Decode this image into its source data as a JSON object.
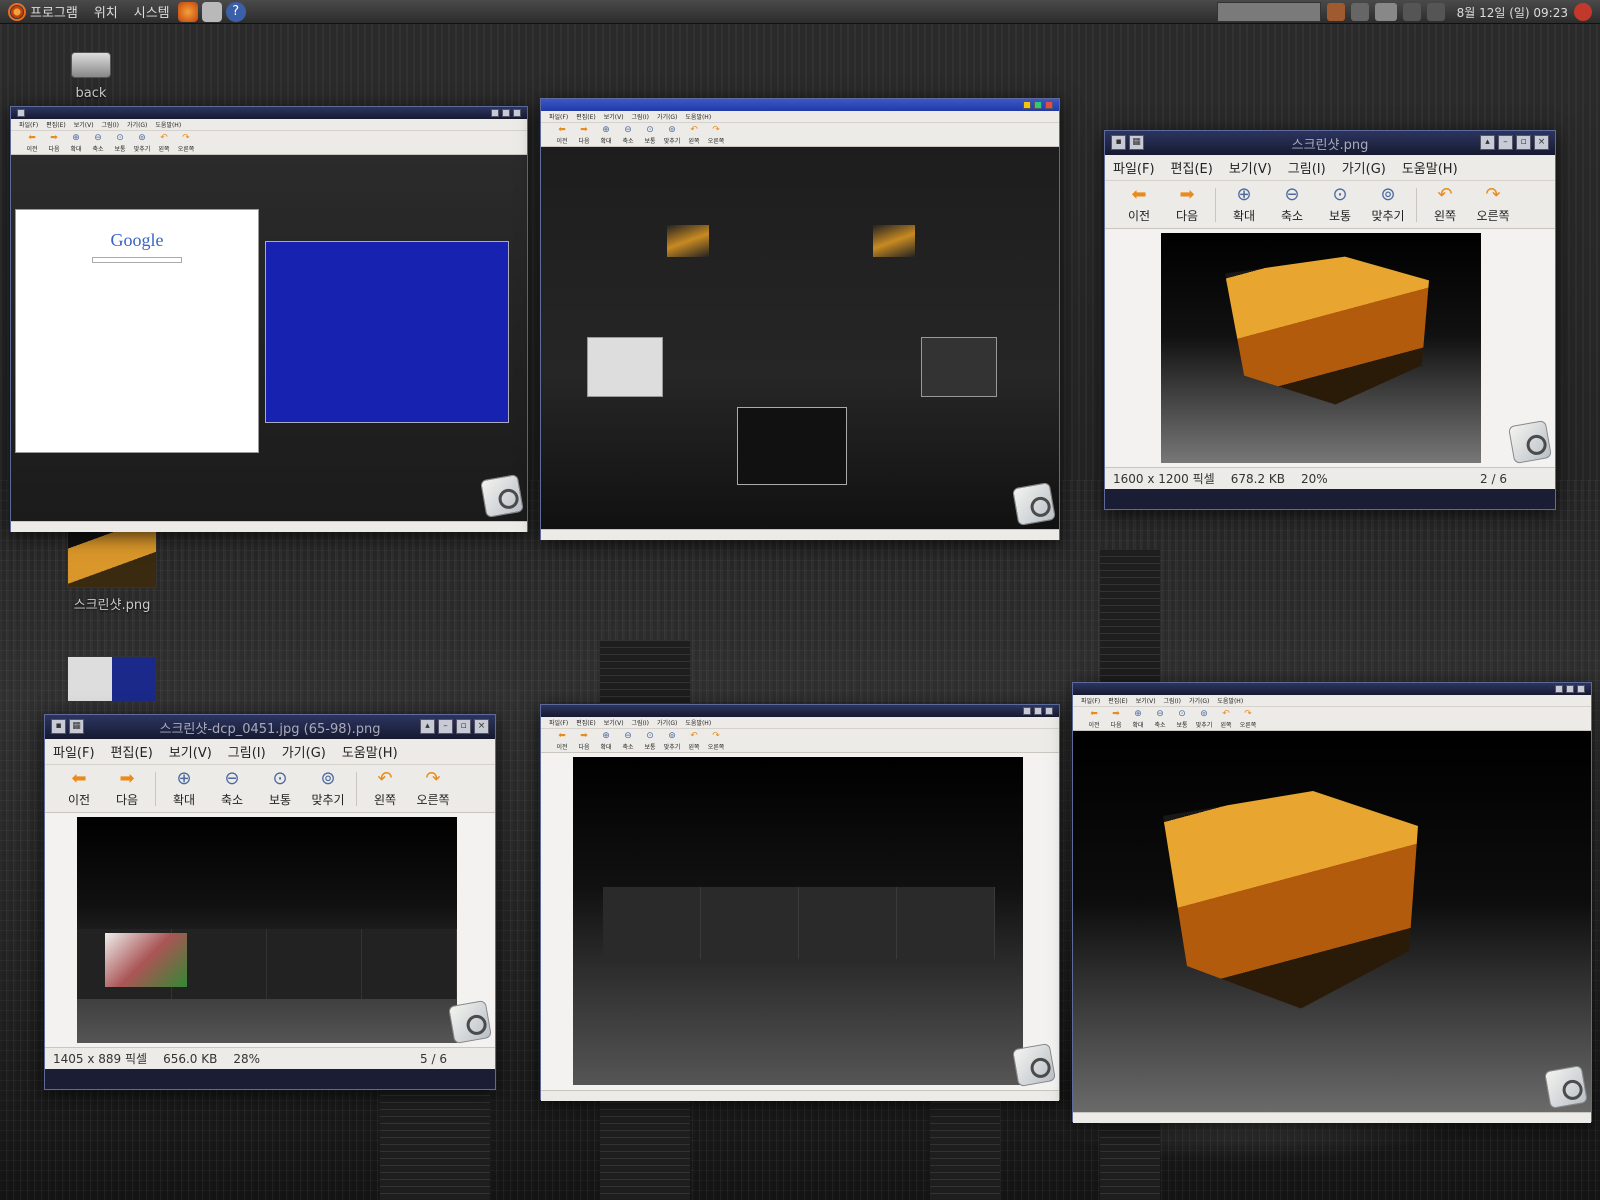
{
  "panel": {
    "menus": [
      "프로그램",
      "위치",
      "시스템"
    ],
    "clock": "8월 12일 (일) 09:23"
  },
  "desktop": {
    "icons": [
      {
        "label": "back"
      },
      {
        "label": "스크린샷.png"
      }
    ]
  },
  "eog": {
    "menu": [
      "파일(F)",
      "편집(E)",
      "보기(V)",
      "그림(I)",
      "가기(G)",
      "도움말(H)"
    ],
    "tools": [
      {
        "label": "이전",
        "icon": "back-arrow-icon"
      },
      {
        "label": "다음",
        "icon": "forward-arrow-icon"
      },
      {
        "label": "확대",
        "icon": "zoom-in-icon"
      },
      {
        "label": "축소",
        "icon": "zoom-out-icon"
      },
      {
        "label": "보통",
        "icon": "zoom-normal-icon"
      },
      {
        "label": "맞추기",
        "icon": "zoom-fit-icon"
      },
      {
        "label": "왼쪽",
        "icon": "rotate-left-icon"
      },
      {
        "label": "오른쪽",
        "icon": "rotate-right-icon"
      }
    ]
  },
  "windows": {
    "w2": {
      "title": "스크린샷.png",
      "dims": "1600 x 1200 픽셀",
      "size": "678.2 KB",
      "zoom": "20%",
      "page": "2 / 6"
    },
    "w4": {
      "title": "스크린샷-dcp_0451.jpg  (65-98).png",
      "dims": "1405 x 889 픽셀",
      "size": "656.0 KB",
      "zoom": "28%",
      "page": "5 / 6"
    }
  },
  "colors": {
    "accent": "#2c3560",
    "panel": "#3a3a3a"
  }
}
